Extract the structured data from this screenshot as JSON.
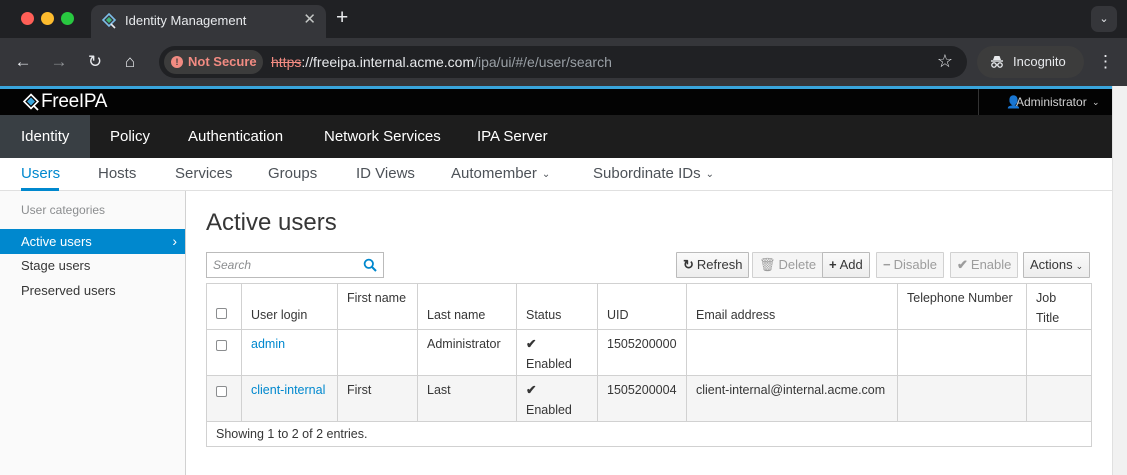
{
  "browser": {
    "tab_title": "Identity Management",
    "security_label": "Not Secure",
    "url_scheme": "https",
    "url_host": "://freeipa.internal.acme.com",
    "url_path": "/ipa/ui/#/e/user/search",
    "incognito_label": "Incognito",
    "colors": {
      "frame": "#202124",
      "toolbar": "#35363a",
      "warning": "#f28b82"
    }
  },
  "brand": {
    "logo_text": "FreeIPA",
    "user_menu": "Administrator"
  },
  "main_nav": [
    {
      "label": "Identity",
      "active": true
    },
    {
      "label": "Policy"
    },
    {
      "label": "Authentication"
    },
    {
      "label": "Network Services"
    },
    {
      "label": "IPA Server"
    }
  ],
  "sub_nav": [
    {
      "label": "Users",
      "active": true
    },
    {
      "label": "Hosts"
    },
    {
      "label": "Services"
    },
    {
      "label": "Groups"
    },
    {
      "label": "ID Views"
    },
    {
      "label": "Automember",
      "dropdown": true
    },
    {
      "label": "Subordinate IDs",
      "dropdown": true
    }
  ],
  "sidebar": {
    "heading": "User categories",
    "items": [
      {
        "label": "Active users",
        "active": true
      },
      {
        "label": "Stage users"
      },
      {
        "label": "Preserved users"
      }
    ]
  },
  "content": {
    "title": "Active users",
    "search_placeholder": "Search",
    "buttons": {
      "refresh": "Refresh",
      "delete": "Delete",
      "add": "Add",
      "disable": "Disable",
      "enable": "Enable",
      "actions": "Actions"
    },
    "columns": {
      "login": "User login",
      "first": "First name",
      "last": "Last name",
      "status": "Status",
      "uid": "UID",
      "email": "Email address",
      "phone": "Telephone Number",
      "job": "Job Title"
    },
    "rows": [
      {
        "login": "admin",
        "first": "",
        "last": "Administrator",
        "status": "Enabled",
        "uid": "1505200000",
        "email": "",
        "phone": "",
        "job": ""
      },
      {
        "login": "client-internal",
        "first": "First",
        "last": "Last",
        "status": "Enabled",
        "uid": "1505200004",
        "email": "client-internal@internal.acme.com",
        "phone": "",
        "job": ""
      }
    ],
    "footer": "Showing 1 to 2 of 2 entries."
  },
  "accent_color": "#0088ce"
}
